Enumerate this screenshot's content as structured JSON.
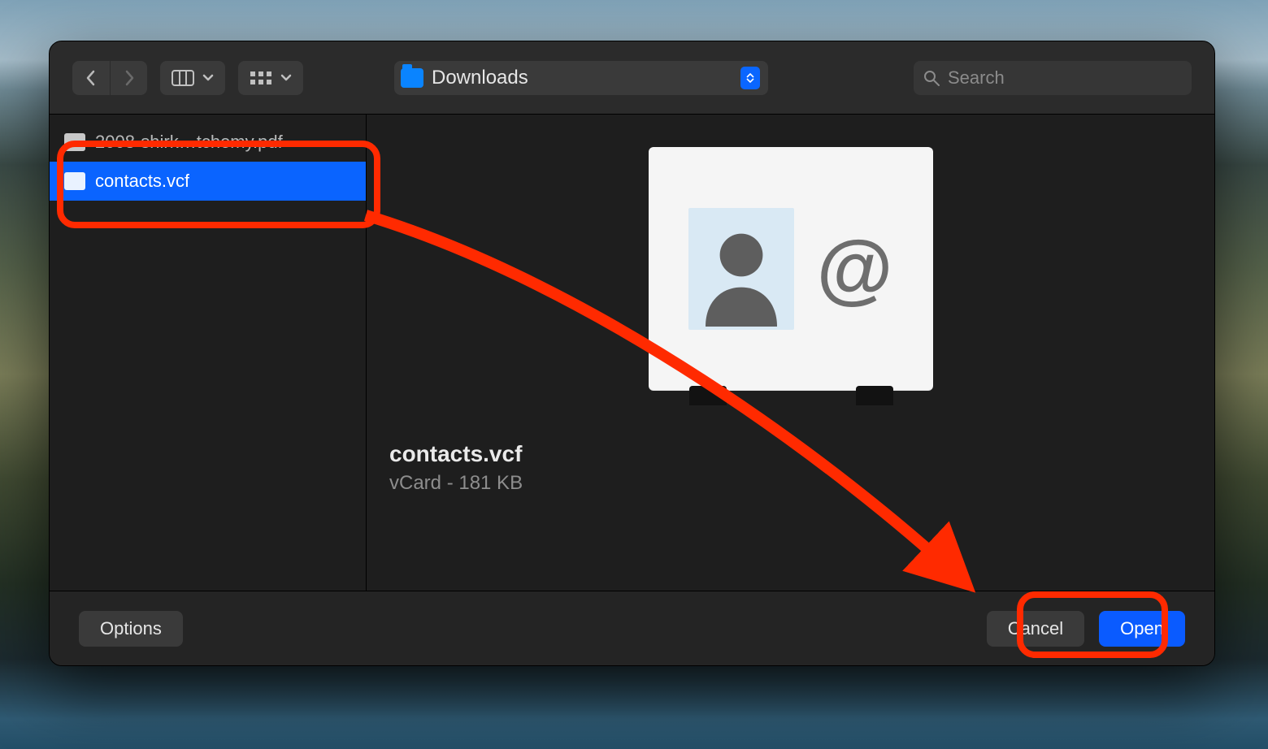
{
  "toolbar": {
    "location_label": "Downloads",
    "search_placeholder": "Search"
  },
  "file_list": {
    "items": [
      {
        "name": "2008-shirk…tchemy.pdf",
        "selected": false
      },
      {
        "name": "contacts.vcf",
        "selected": true
      }
    ]
  },
  "preview": {
    "filename": "contacts.vcf",
    "subtitle": "vCard - 181 KB"
  },
  "footer": {
    "options_label": "Options",
    "cancel_label": "Cancel",
    "open_label": "Open"
  },
  "annotation": {
    "highlight_file": true,
    "highlight_open": true,
    "arrow_from_file_to_open": true
  }
}
